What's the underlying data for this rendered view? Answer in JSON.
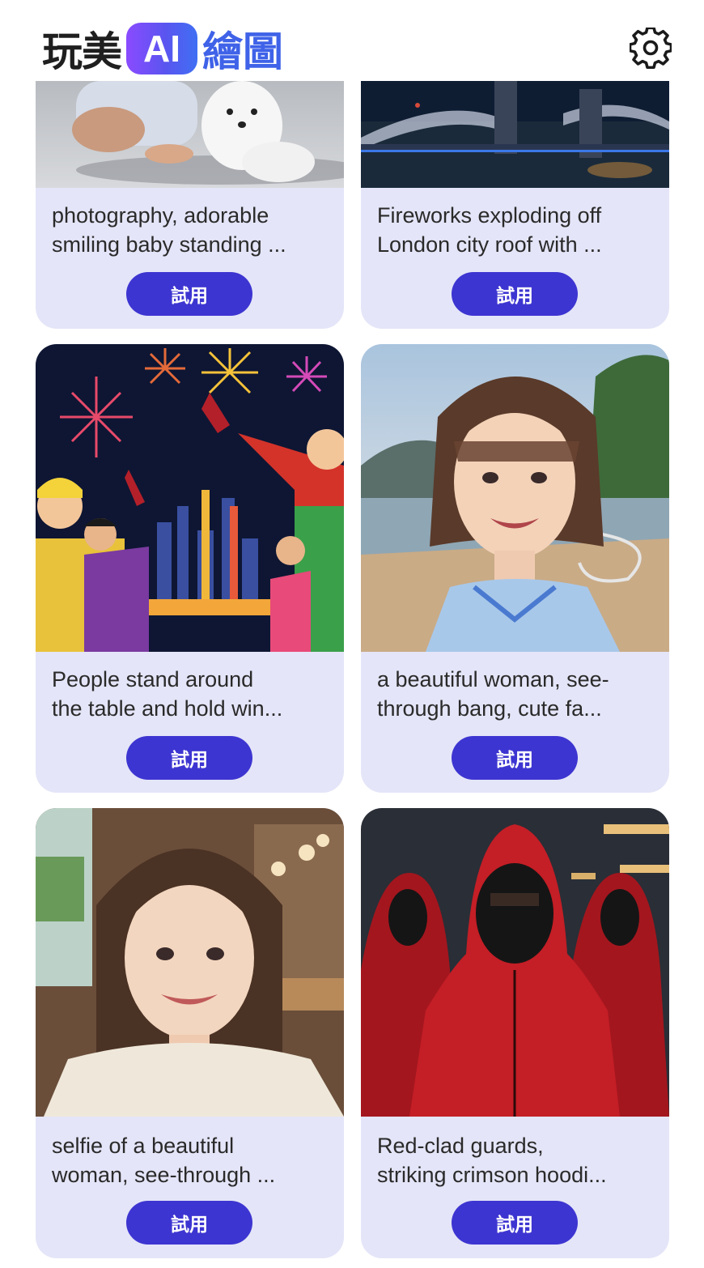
{
  "header": {
    "logo_part1": "玩美",
    "logo_ai": "AI",
    "logo_part2": "繪圖",
    "settings_icon": "gear-icon"
  },
  "cards": [
    {
      "line1": "photography, adorable",
      "line2": "smiling baby standing ...",
      "button": "試用",
      "image": "baby-and-white-puppy"
    },
    {
      "line1": "Fireworks exploding off",
      "line2": "London city roof with ...",
      "button": "試用",
      "image": "tower-bridge-night"
    },
    {
      "line1": "People stand around",
      "line2": "the table and hold win...",
      "button": "試用",
      "image": "party-fireworks-illustration"
    },
    {
      "line1": "a beautiful woman, see-",
      "line2": "through bang, cute fa...",
      "button": "試用",
      "image": "woman-at-beach"
    },
    {
      "line1": "selfie of a beautiful",
      "line2": "woman, see-through ...",
      "button": "試用",
      "image": "woman-selfie-cafe"
    },
    {
      "line1": "Red-clad guards,",
      "line2": "striking crimson hoodi...",
      "button": "試用",
      "image": "red-hooded-guards"
    }
  ]
}
